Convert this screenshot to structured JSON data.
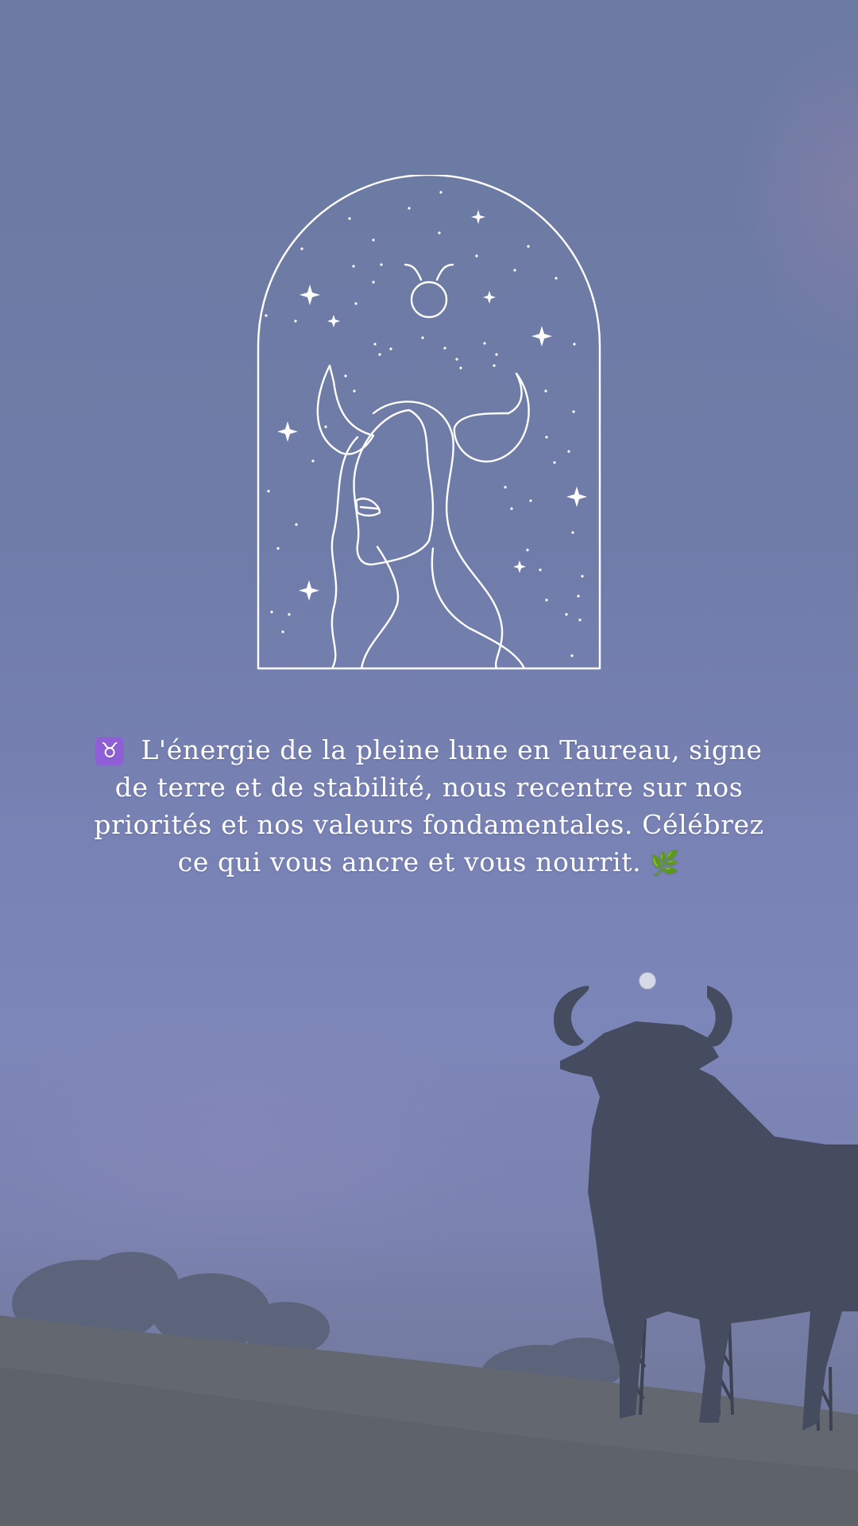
{
  "caption": {
    "taurus_symbol": "♉",
    "text": "L'énergie de la pleine lune en Taureau, signe de terre et de stabilité, nous recentre sur nos priorités et nos valeurs fondamentales. Célébrez ce qui vous ancre et vous nourrit.",
    "leaf_symbol": "🌿"
  },
  "emblem": {
    "zodiac_sign": "taurus-symbol-icon",
    "figure": "taurus-woman-line-art",
    "line_color": "#ffffff"
  },
  "background": {
    "sky_color": "#6f7ca8",
    "bull_silhouette_color": "#454c60",
    "hill_color": "#5f6670"
  }
}
